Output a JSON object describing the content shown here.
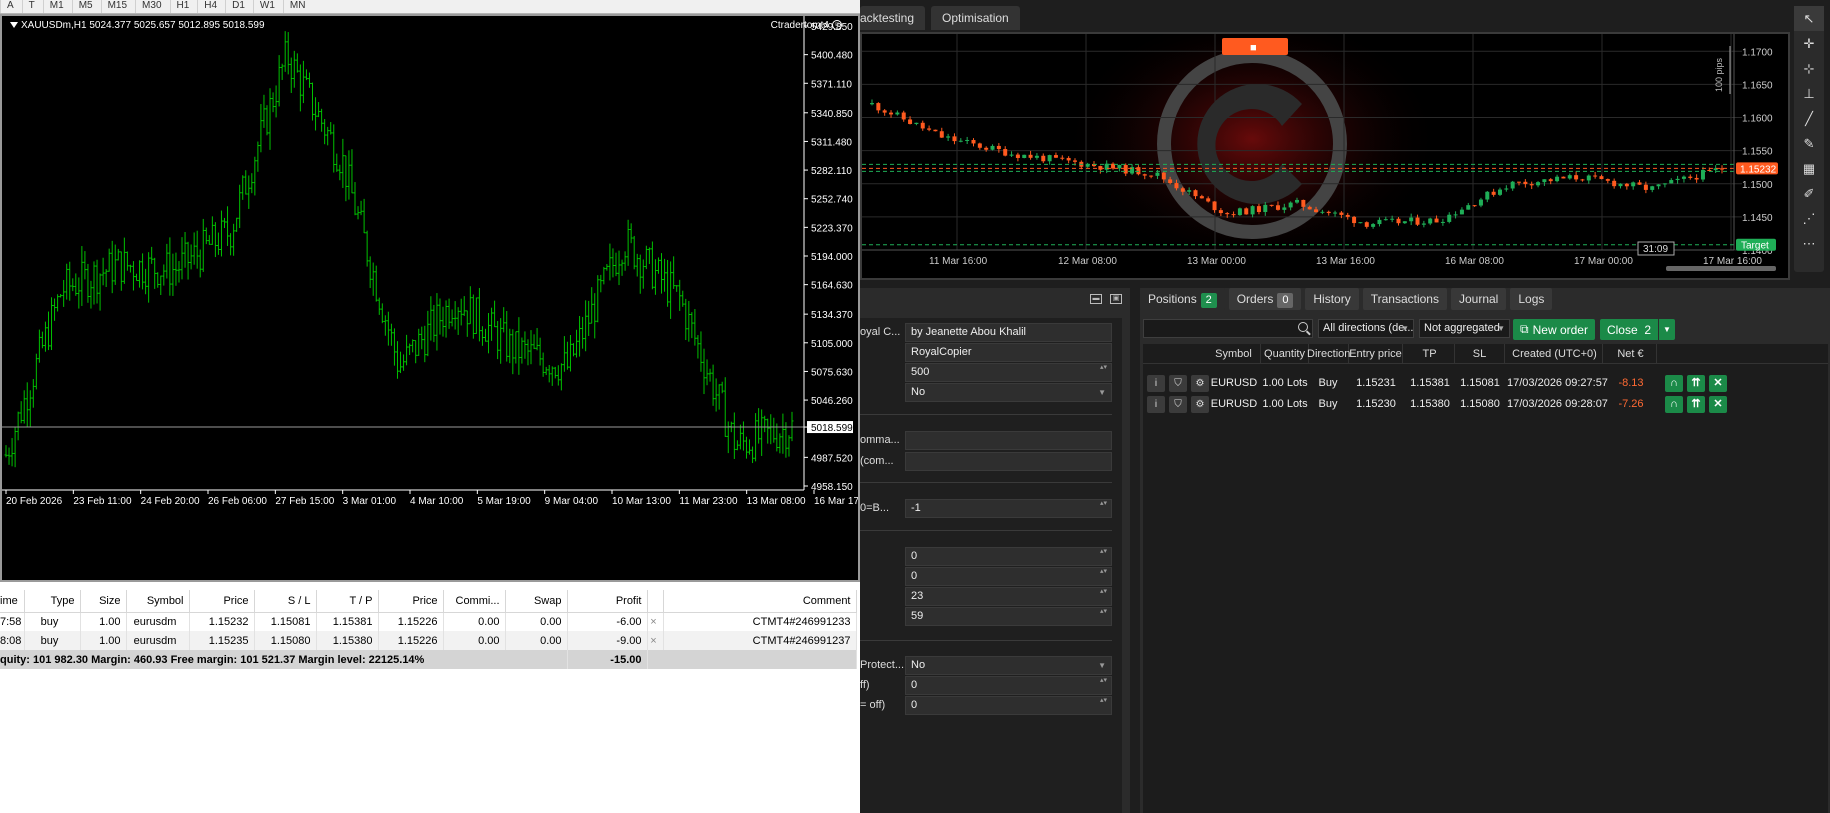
{
  "mt4": {
    "toolbar": [
      "A",
      "T",
      "M1",
      "M5",
      "M15",
      "M30",
      "H1",
      "H4",
      "D1",
      "W1",
      "MN"
    ],
    "symbol_header": "XAUUSDm,H1  5024.377 5025.657 5012.895 5018.599",
    "ea_name": "Ctradertomt4",
    "price_axis": [
      "5429.850",
      "5400.480",
      "5371.110",
      "5340.850",
      "5311.480",
      "5282.110",
      "5252.740",
      "5223.370",
      "5194.000",
      "5164.630",
      "5134.370",
      "5105.000",
      "5075.630",
      "5046.260",
      "5018.599",
      "4987.520",
      "4958.150"
    ],
    "current_price": "5018.599",
    "time_axis": [
      "20 Feb 2026",
      "23 Feb 11:00",
      "24 Feb 20:00",
      "26 Feb 06:00",
      "27 Feb 15:00",
      "3 Mar 01:00",
      "4 Mar 10:00",
      "5 Mar 19:00",
      "9 Mar 04:00",
      "10 Mar 13:00",
      "11 Mar 23:00",
      "13 Mar 08:00",
      "16 Mar 17:00"
    ],
    "chart_data": {
      "type": "bar",
      "title": "XAUUSDm,H1",
      "x_range": [
        "20 Feb 2026",
        "16 Mar 17:00"
      ],
      "ylim": [
        4958.15,
        5429.85
      ],
      "key_closes": [
        {
          "time": "20 Feb 2026",
          "close": 4990
        },
        {
          "time": "23 Feb 11:00",
          "close": 5160
        },
        {
          "time": "24 Feb 20:00",
          "close": 5185
        },
        {
          "time": "26 Feb 06:00",
          "close": 5180
        },
        {
          "time": "27 Feb 15:00",
          "close": 5220
        },
        {
          "time": "28 Feb",
          "close": 5400
        },
        {
          "time": "3 Mar 01:00",
          "close": 5290
        },
        {
          "time": "3 Mar 06:00",
          "close": 5080
        },
        {
          "time": "4 Mar 10:00",
          "close": 5150
        },
        {
          "time": "5 Mar 19:00",
          "close": 5100
        },
        {
          "time": "9 Mar 04:00",
          "close": 5080
        },
        {
          "time": "10 Mar 13:00",
          "close": 5210
        },
        {
          "time": "11 Mar 23:00",
          "close": 5150
        },
        {
          "time": "13 Mar 08:00",
          "close": 5000
        },
        {
          "time": "16 Mar 17:00",
          "close": 5018.599
        }
      ],
      "series_color": "#00c000",
      "grid": false
    },
    "table": {
      "headers": [
        "ime",
        "Type",
        "Size",
        "Symbol",
        "Price",
        "S / L",
        "T / P",
        "Price",
        "Commi...",
        "Swap",
        "Profit",
        "",
        "Comment"
      ],
      "rows": [
        [
          "7:58",
          "buy",
          "1.00",
          "eurusdm",
          "1.15232",
          "1.15081",
          "1.15381",
          "1.15226",
          "0.00",
          "0.00",
          "-6.00",
          "×",
          "CTMT4#246991233"
        ],
        [
          "8:08",
          "buy",
          "1.00",
          "eurusdm",
          "1.15235",
          "1.15080",
          "1.15380",
          "1.15226",
          "0.00",
          "0.00",
          "-9.00",
          "×",
          "CTMT4#246991237"
        ]
      ],
      "summary": "quity: 101 982.30  Margin: 460.93  Free margin: 101 521.37  Margin level: 22125.14%",
      "summary_profit": "-15.00"
    }
  },
  "ctrader": {
    "tabs": [
      "acktesting",
      "Optimisation"
    ],
    "chart": {
      "price_axis": [
        "1.1700",
        "1.1650",
        "1.1600",
        "1.1550",
        "1.1500",
        "1.1450",
        "1.1400"
      ],
      "current_price": "1.15232",
      "target_label": "Target",
      "pips_label": "100 pips",
      "countdown": "31:09",
      "time_axis": [
        "11 Mar 16:00",
        "12 Mar 08:00",
        "13 Mar 00:00",
        "13 Mar 16:00",
        "16 Mar 08:00",
        "17 Mar 00:00",
        "17 Mar 16:00"
      ],
      "stop_button": "■",
      "chart_data": {
        "type": "line",
        "title": "",
        "x_range": [
          "11 Mar",
          "17 Mar 16:00"
        ],
        "ylim": [
          1.14,
          1.172
        ],
        "key_closes": [
          {
            "time": "11 Mar 08:00",
            "close": 1.162
          },
          {
            "time": "11 Mar 20:00",
            "close": 1.157
          },
          {
            "time": "12 Mar 08:00",
            "close": 1.1545
          },
          {
            "time": "12 Mar 20:00",
            "close": 1.153
          },
          {
            "time": "13 Mar 00:00",
            "close": 1.1515
          },
          {
            "time": "13 Mar 10:00",
            "close": 1.1455
          },
          {
            "time": "13 Mar 16:00",
            "close": 1.147
          },
          {
            "time": "16 Mar 00:00",
            "close": 1.144
          },
          {
            "time": "16 Mar 08:00",
            "close": 1.1445
          },
          {
            "time": "16 Mar 20:00",
            "close": 1.15
          },
          {
            "time": "17 Mar 00:00",
            "close": 1.151
          },
          {
            "time": "17 Mar 12:00",
            "close": 1.1492
          },
          {
            "time": "17 Mar 16:00",
            "close": 1.15232
          }
        ],
        "up_color": "#1fae57",
        "down_color": "#ff5a1f"
      }
    },
    "tools": [
      "↖",
      "✛",
      "⊹",
      "⊥",
      "╱",
      "✎",
      "▦",
      "✐",
      "⋰",
      "⋯"
    ],
    "cbot": {
      "fields": [
        {
          "label": "oyal C...",
          "value": "by Jeanette Abou Khalil",
          "kind": "text"
        },
        {
          "label": "",
          "value": "RoyalCopier",
          "kind": "text"
        },
        {
          "label": "",
          "value": "500",
          "kind": "num"
        },
        {
          "label": "",
          "value": "No",
          "kind": "select"
        },
        {
          "label": "omma...",
          "value": "",
          "kind": "text"
        },
        {
          "label": "(com...",
          "value": "",
          "kind": "text"
        },
        {
          "label": "0=B...",
          "value": "-1",
          "kind": "num"
        },
        {
          "label": "",
          "value": "0",
          "kind": "num"
        },
        {
          "label": "",
          "value": "0",
          "kind": "num"
        },
        {
          "label": "",
          "value": "23",
          "kind": "num"
        },
        {
          "label": "",
          "value": "59",
          "kind": "num"
        },
        {
          "label": "Protect...",
          "value": "No",
          "kind": "select"
        },
        {
          "label": "ff)",
          "value": "0",
          "kind": "num"
        },
        {
          "label": "= off)",
          "value": "0",
          "kind": "num"
        }
      ]
    },
    "positions": {
      "tabs": [
        {
          "label": "Positions",
          "badge": "2"
        },
        {
          "label": "Orders",
          "badge": "0"
        },
        {
          "label": "History"
        },
        {
          "label": "Transactions"
        },
        {
          "label": "Journal"
        },
        {
          "label": "Logs"
        }
      ],
      "filter_direction": "All directions (de...",
      "filter_aggregation": "Not aggregated",
      "new_order": "New order",
      "close": "Close",
      "close_count": "2",
      "headers": [
        "Symbol",
        "Quantity",
        "Direction",
        "Entry price",
        "TP",
        "SL",
        "Created (UTC+0)",
        "Net €"
      ],
      "rows": [
        [
          "EURUSD",
          "1.00 Lots",
          "Buy",
          "1.15231",
          "1.15381",
          "1.15081",
          "17/03/2026 09:27:57",
          "-8.13"
        ],
        [
          "EURUSD",
          "1.00 Lots",
          "Buy",
          "1.15230",
          "1.15380",
          "1.15080",
          "17/03/2026 09:28:07",
          "-7.26"
        ]
      ]
    }
  }
}
